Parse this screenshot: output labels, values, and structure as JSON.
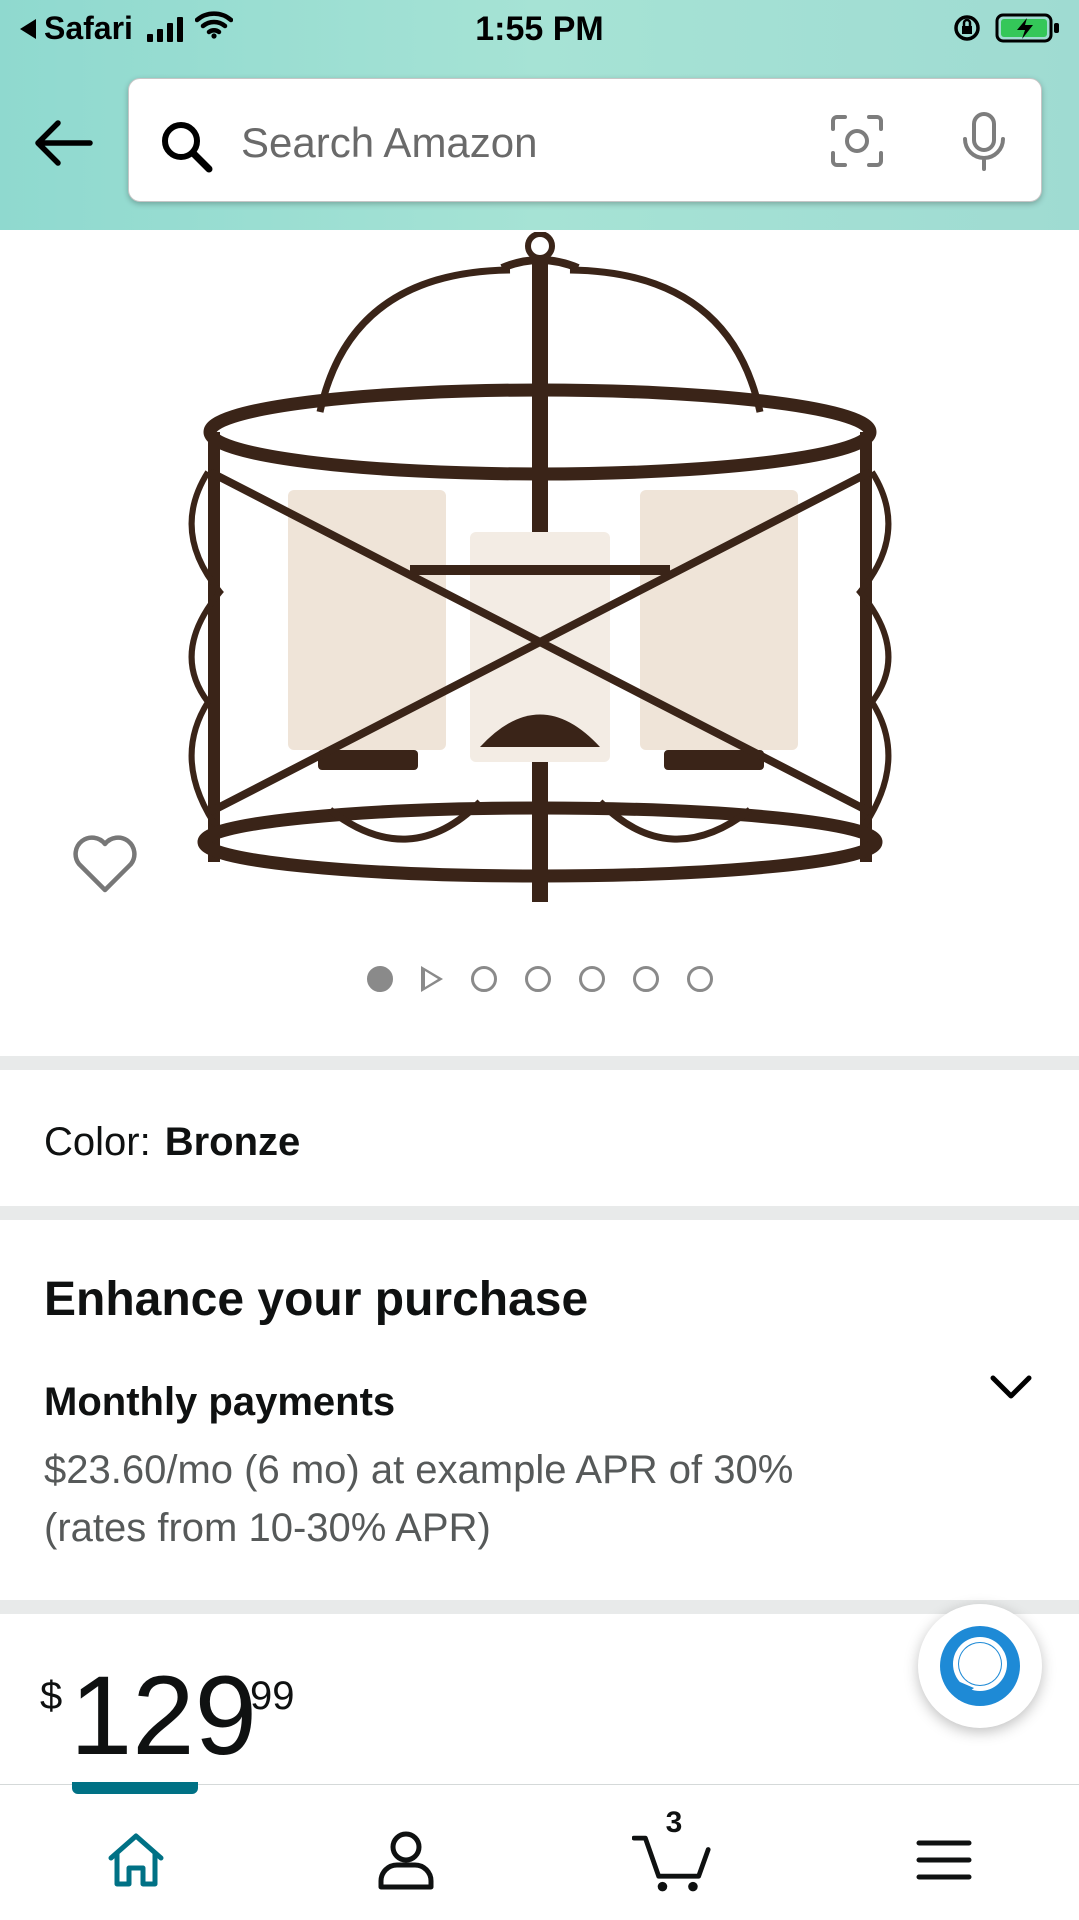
{
  "status_bar": {
    "back_app": "Safari",
    "time": "1:55 PM"
  },
  "search": {
    "placeholder": "Search Amazon"
  },
  "carousel": {
    "count": 7,
    "active_index": 0,
    "video_index": 1
  },
  "variation": {
    "label": "Color:",
    "value": "Bronze"
  },
  "enhance": {
    "title": "Enhance your purchase",
    "monthly_title": "Monthly payments",
    "monthly_line1": "$23.60/mo (6 mo) at example APR of 30%",
    "monthly_line2": "(rates from 10-30% APR)"
  },
  "price": {
    "symbol": "$",
    "whole": "129",
    "fraction": "99"
  },
  "bottom_nav": {
    "items": [
      "home-icon",
      "account-icon",
      "cart-icon",
      "menu-icon"
    ],
    "active": "home",
    "cart_count": "3"
  },
  "colors": {
    "accent": "#007185",
    "header_teal": "#a6e3d5",
    "alexa_blue": "#1e8ad6"
  }
}
